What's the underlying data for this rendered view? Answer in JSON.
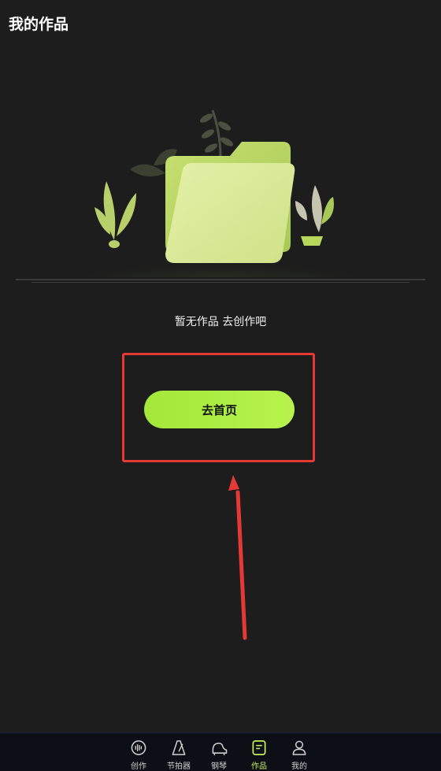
{
  "header": {
    "title": "我的作品"
  },
  "empty_state": {
    "message": "暂无作品 去创作吧",
    "button_label": "去首页"
  },
  "colors": {
    "background": "#1d1d1d",
    "accent": "#b0f046",
    "annotation": "#e53935",
    "nav_background": "#0c0f15"
  },
  "bottom_nav": {
    "items": [
      {
        "label": "创作",
        "icon": "waveform-icon"
      },
      {
        "label": "节拍器",
        "icon": "metronome-icon"
      },
      {
        "label": "钢琴",
        "icon": "piano-icon"
      },
      {
        "label": "作品",
        "icon": "works-icon",
        "active": true
      },
      {
        "label": "我的",
        "icon": "profile-icon"
      }
    ]
  }
}
